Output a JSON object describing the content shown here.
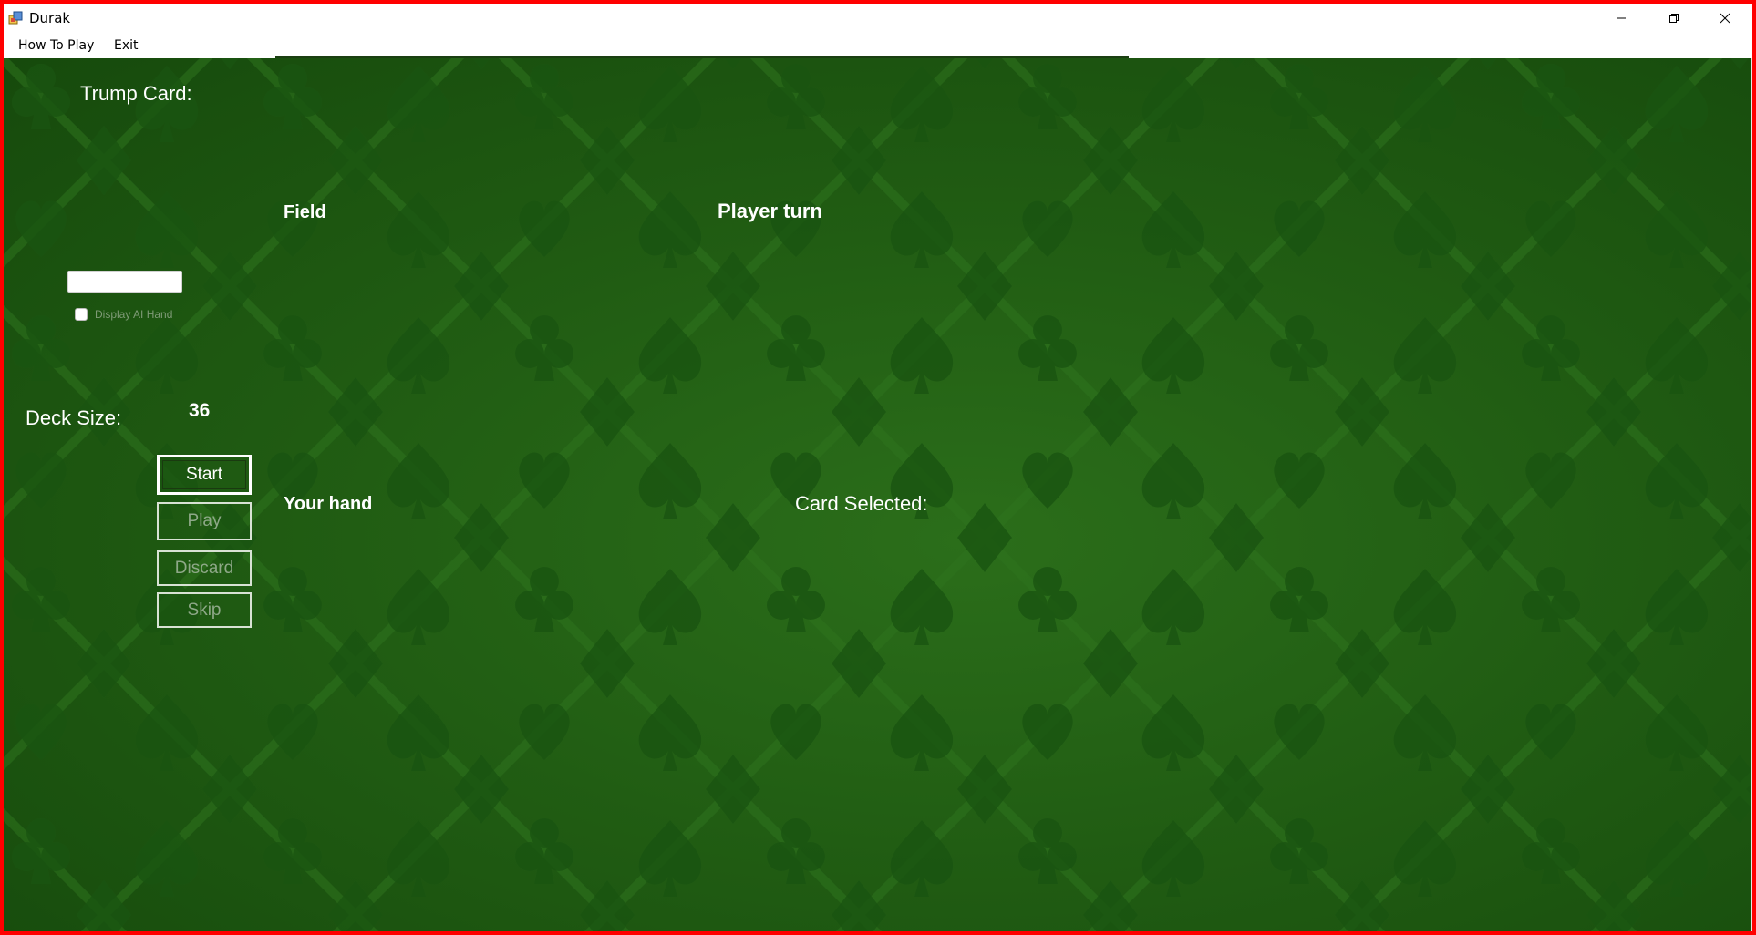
{
  "window": {
    "title": "Durak",
    "icon": "app-window-icon",
    "controls": {
      "minimize_icon": "minimize-icon",
      "restore_icon": "restore-icon",
      "close_icon": "close-icon"
    },
    "border_color": "#ff0000"
  },
  "menu": {
    "items": [
      {
        "label": "How To Play"
      },
      {
        "label": "Exit"
      }
    ]
  },
  "game": {
    "background_color": "#215d13",
    "pattern_icons": [
      "club-icon",
      "spade-icon",
      "heart-icon",
      "diamond-icon"
    ],
    "trump_label": "Trump Card:",
    "field_label": "Field",
    "turn_label": "Player turn",
    "ai_hand_input_value": "",
    "display_ai_hand_label": "Display AI Hand",
    "display_ai_hand_checked": false,
    "deck_size_label": "Deck Size:",
    "deck_size_value": "36",
    "hand_label": "Your hand",
    "card_selected_label": "Card Selected:",
    "buttons": {
      "start": "Start",
      "play": "Play",
      "discard": "Discard",
      "skip": "Skip"
    }
  }
}
